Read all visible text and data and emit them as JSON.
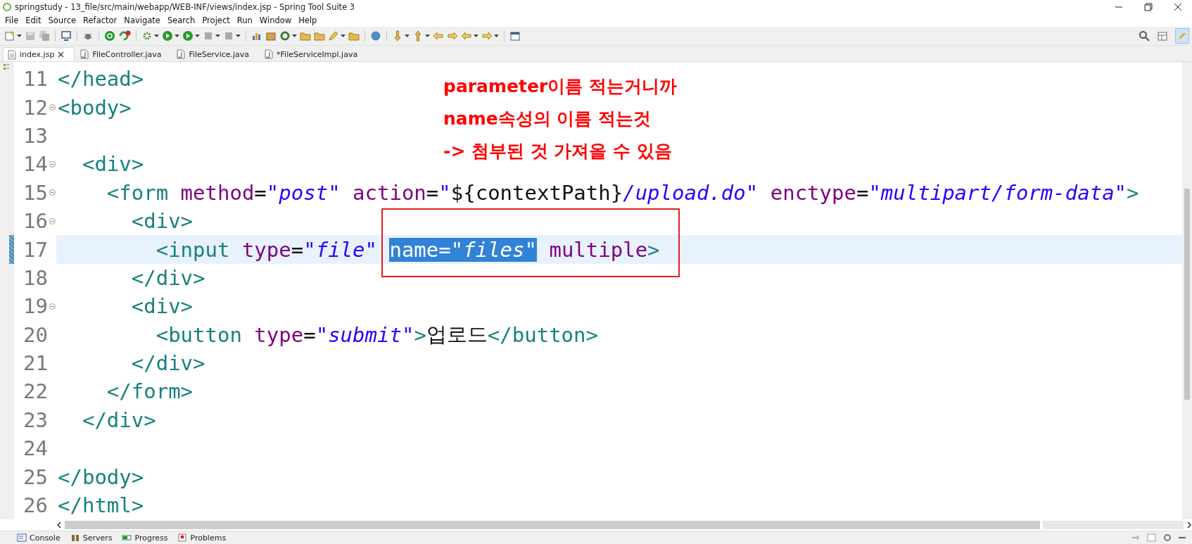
{
  "window": {
    "title": "springstudy - 13_file/src/main/webapp/WEB-INF/views/index.jsp - Spring Tool Suite 3"
  },
  "menu": [
    "File",
    "Edit",
    "Source",
    "Refactor",
    "Navigate",
    "Search",
    "Project",
    "Run",
    "Window",
    "Help"
  ],
  "tabs": [
    {
      "label": "index.jsp",
      "kind": "jsp",
      "selected": true
    },
    {
      "label": "FileController.java",
      "kind": "java",
      "selected": false
    },
    {
      "label": "FileService.java",
      "kind": "java",
      "selected": false
    },
    {
      "label": "*FileServiceImpl.java",
      "kind": "java",
      "selected": false
    }
  ],
  "editor": {
    "lines": [
      {
        "number": "11",
        "foldable": false,
        "current": false,
        "changed": false,
        "tokens": [
          {
            "kind": "tag",
            "text": "</head>",
            "selected": false
          }
        ]
      },
      {
        "number": "12",
        "foldable": true,
        "current": false,
        "changed": false,
        "tokens": [
          {
            "kind": "tag",
            "text": "<body>",
            "selected": false
          }
        ]
      },
      {
        "number": "13",
        "foldable": false,
        "current": false,
        "changed": false
      },
      {
        "number": "14",
        "foldable": true,
        "current": false,
        "changed": false,
        "tokens": [
          {
            "kind": "tag",
            "text": "  <div>",
            "selected": false
          }
        ]
      },
      {
        "number": "15",
        "foldable": true,
        "current": false,
        "changed": false,
        "tokens": [
          {
            "kind": "tag",
            "text": "    <form",
            "selected": false
          },
          {
            "kind": "attr",
            "text": " method",
            "selected": false
          },
          {
            "kind": "op",
            "text": "=",
            "selected": false
          },
          {
            "kind": "str",
            "text": "\"post\"",
            "selected": false
          },
          {
            "kind": "attr",
            "text": " action",
            "selected": false
          },
          {
            "kind": "op",
            "text": "=",
            "selected": false
          },
          {
            "kind": "str",
            "text": "\"",
            "selected": false
          },
          {
            "kind": "plain",
            "text": "${contextPath}",
            "selected": false
          },
          {
            "kind": "str",
            "text": "/upload.do\"",
            "selected": false
          },
          {
            "kind": "attr",
            "text": " enctype",
            "selected": false
          },
          {
            "kind": "op",
            "text": "=",
            "selected": false
          },
          {
            "kind": "str",
            "text": "\"multipart/form-data\"",
            "selected": false
          },
          {
            "kind": "tag",
            "text": ">",
            "selected": false
          }
        ]
      },
      {
        "number": "16",
        "foldable": true,
        "current": false,
        "changed": false,
        "tokens": [
          {
            "kind": "tag",
            "text": "      <div>",
            "selected": false
          }
        ]
      },
      {
        "number": "17",
        "foldable": false,
        "current": true,
        "changed": true,
        "tokens": [
          {
            "kind": "tag",
            "text": "        <input",
            "selected": false
          },
          {
            "kind": "attr",
            "text": " type",
            "selected": false
          },
          {
            "kind": "op",
            "text": "=",
            "selected": false
          },
          {
            "kind": "str",
            "text": "\"file\" ",
            "selected": false
          },
          {
            "kind": "attr",
            "text": "name",
            "selected": true
          },
          {
            "kind": "op",
            "text": "=",
            "selected": true
          },
          {
            "kind": "str",
            "text": "\"files\"",
            "selected": true
          },
          {
            "kind": "attr",
            "text": " multiple",
            "selected": false
          },
          {
            "kind": "tag",
            "text": ">",
            "selected": false
          }
        ]
      },
      {
        "number": "18",
        "foldable": false,
        "current": false,
        "changed": false,
        "tokens": [
          {
            "kind": "tag",
            "text": "      </div>",
            "selected": false
          }
        ]
      },
      {
        "number": "19",
        "foldable": true,
        "current": false,
        "changed": false,
        "tokens": [
          {
            "kind": "tag",
            "text": "      <div>",
            "selected": false
          }
        ]
      },
      {
        "number": "20",
        "foldable": false,
        "current": false,
        "changed": false,
        "tokens": [
          {
            "kind": "tag",
            "text": "        <button",
            "selected": false
          },
          {
            "kind": "attr",
            "text": " type",
            "selected": false
          },
          {
            "kind": "op",
            "text": "=",
            "selected": false
          },
          {
            "kind": "str",
            "text": "\"submit\"",
            "selected": false
          },
          {
            "kind": "tag",
            "text": ">",
            "selected": false
          },
          {
            "kind": "plain",
            "text": "업로드",
            "selected": false
          },
          {
            "kind": "tag",
            "text": "</button>",
            "selected": false
          }
        ]
      },
      {
        "number": "21",
        "foldable": false,
        "current": false,
        "changed": false,
        "tokens": [
          {
            "kind": "tag",
            "text": "      </div>",
            "selected": false
          }
        ]
      },
      {
        "number": "22",
        "foldable": false,
        "current": false,
        "changed": false,
        "tokens": [
          {
            "kind": "tag",
            "text": "    </form>",
            "selected": false
          }
        ]
      },
      {
        "number": "23",
        "foldable": false,
        "current": false,
        "changed": false,
        "tokens": [
          {
            "kind": "tag",
            "text": "  </div>",
            "selected": false
          }
        ]
      },
      {
        "number": "24",
        "foldable": false,
        "current": false,
        "changed": false
      },
      {
        "number": "25",
        "foldable": false,
        "current": false,
        "changed": false,
        "tokens": [
          {
            "kind": "tag",
            "text": "</body>",
            "selected": false
          }
        ]
      },
      {
        "number": "26",
        "foldable": false,
        "current": false,
        "changed": false,
        "tokens": [
          {
            "kind": "tag",
            "text": "</html>",
            "selected": false
          }
        ]
      }
    ]
  },
  "annotation": {
    "lines": [
      "parameter이름 적는거니까",
      "name속성의 이름 적는것",
      "-> 첨부된 것 가져올 수 있음"
    ]
  },
  "bottom_tabs": [
    {
      "label": "Console",
      "kind": "console"
    },
    {
      "label": "Servers",
      "kind": "servers"
    },
    {
      "label": "Progress",
      "kind": "progress"
    },
    {
      "label": "Problems",
      "kind": "problems"
    }
  ]
}
